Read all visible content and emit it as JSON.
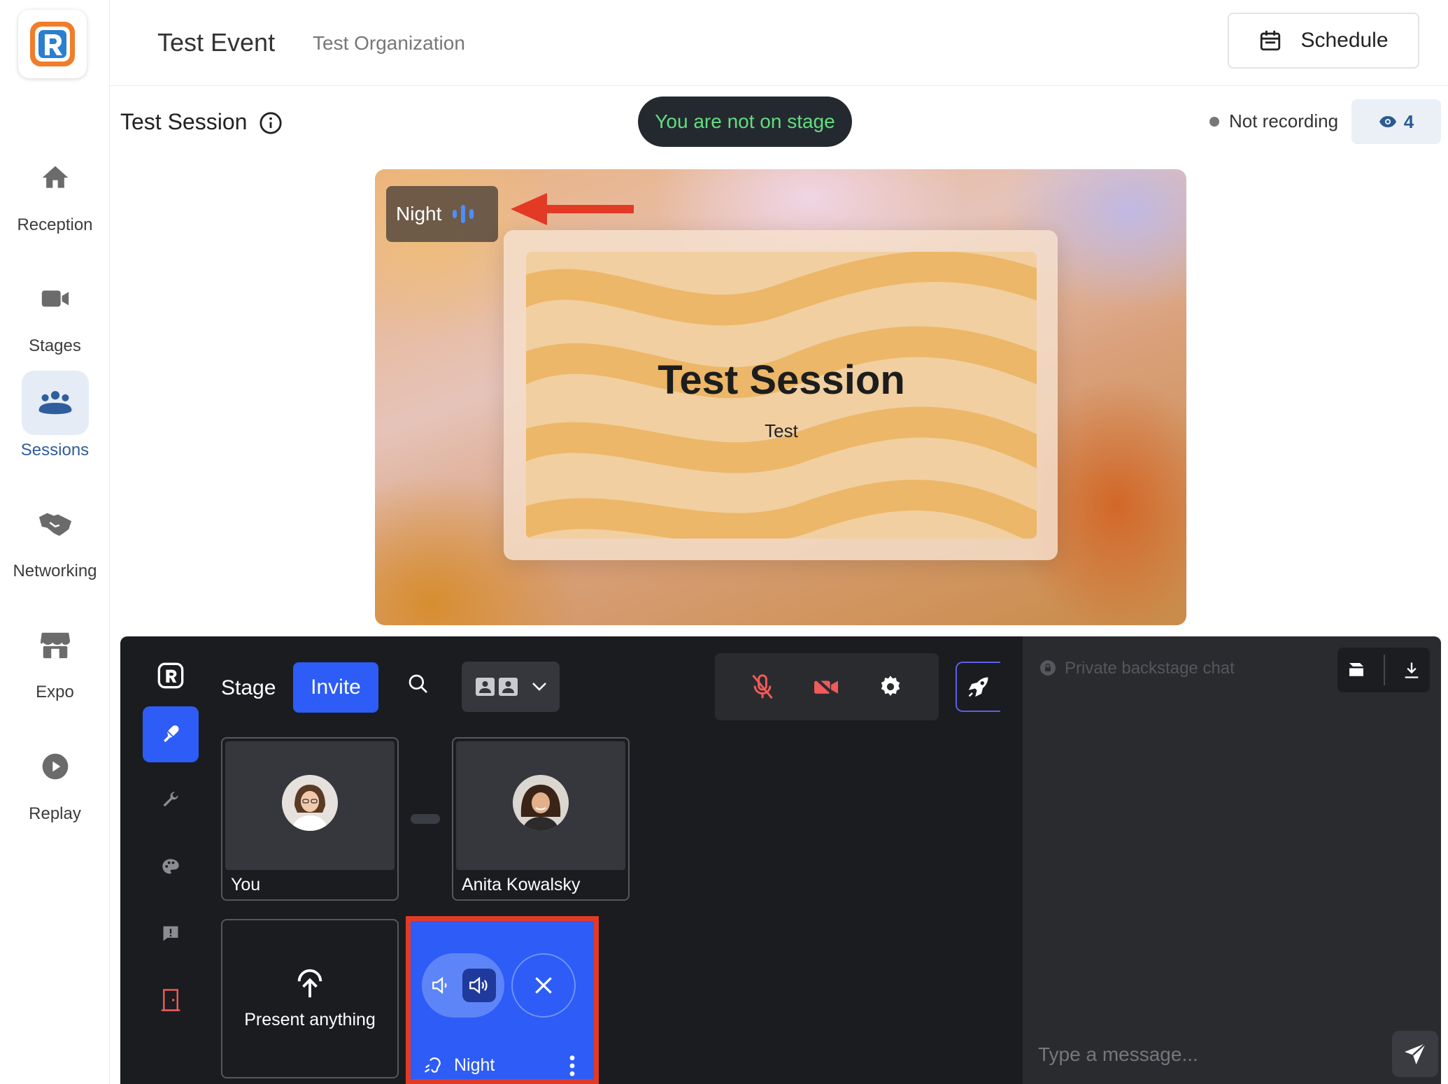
{
  "sidebar": {
    "items": [
      {
        "label": "Reception",
        "icon": "home-icon"
      },
      {
        "label": "Stages",
        "icon": "video-camera-icon"
      },
      {
        "label": "Sessions",
        "icon": "group-icon",
        "active": true
      },
      {
        "label": "Networking",
        "icon": "handshake-icon"
      },
      {
        "label": "Expo",
        "icon": "store-icon"
      },
      {
        "label": "Replay",
        "icon": "play-icon"
      }
    ]
  },
  "header": {
    "event_title": "Test Event",
    "organization": "Test Organization",
    "schedule_label": "Schedule"
  },
  "session": {
    "title": "Test Session",
    "stage_status": "You are not on stage",
    "recording_status": "Not recording",
    "viewer_count": "4"
  },
  "stage_preview": {
    "speaker_tag": "Night",
    "slide_title": "Test Session",
    "slide_subtitle": "Test"
  },
  "backstage": {
    "stage_label": "Stage",
    "invite_label": "Invite",
    "participants": [
      {
        "name": "You"
      },
      {
        "name": "Anita Kowalsky"
      }
    ],
    "present_label": "Present anything",
    "audio_source_name": "Night"
  },
  "chat": {
    "title": "Private backstage chat",
    "input_placeholder": "Type a message..."
  },
  "colors": {
    "accent": "#2d5cf6",
    "stage_status_text": "#61de7d",
    "highlight_box": "#e33a25",
    "annotation_arrow": "#e33a25",
    "muted_control": "#f05a5a",
    "sidebar_active": "#2f5e9c"
  }
}
